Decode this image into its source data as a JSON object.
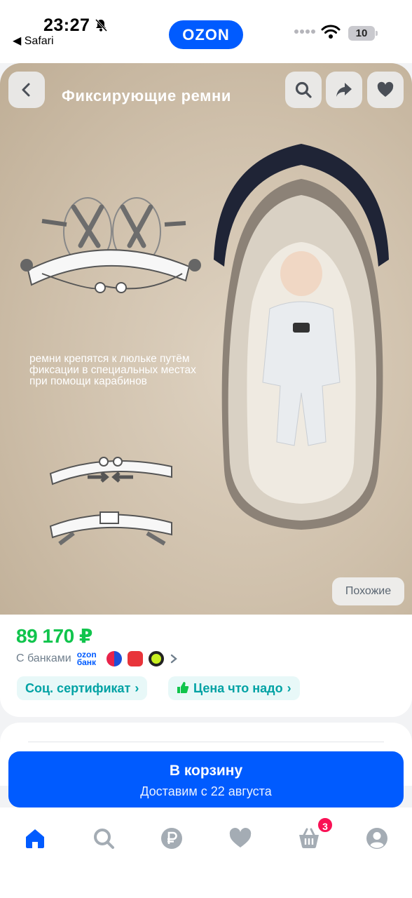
{
  "status_bar": {
    "time": "23:27",
    "back_app": "◀ Safari",
    "battery": "10"
  },
  "header": {
    "logo": "OZON"
  },
  "product_image": {
    "title": "Фиксирующие ремни",
    "caption": "ремни крепятся к люльке путём фиксации в специальных местах при помощи карабинов",
    "similar_label": "Похожие"
  },
  "price": {
    "value": "89 170 ₽",
    "banks_label": "С банками",
    "ozon_bank_label": "ozon банк",
    "chips": [
      {
        "label": "Соц. сертификат"
      },
      {
        "label": "Цена что надо"
      }
    ]
  },
  "cart": {
    "title": "В корзину",
    "subtitle": "Доставим с 22 августа"
  },
  "tabbar": {
    "cart_badge": "3"
  },
  "colors": {
    "accent": "#005bff",
    "price": "#10c44c",
    "badge": "#f91155",
    "chip_text": "#00a2a4"
  },
  "icons": [
    "back-icon",
    "search-icon",
    "share-icon",
    "heart-icon",
    "home-icon",
    "ruble-icon",
    "cart-icon",
    "profile-icon"
  ]
}
